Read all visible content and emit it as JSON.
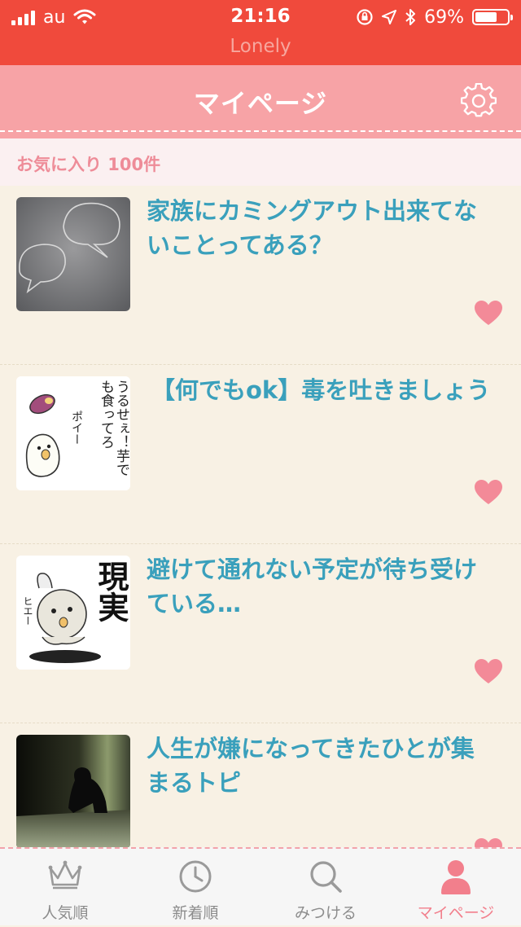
{
  "status_bar": {
    "carrier": "au",
    "time": "21:16",
    "battery": "69%",
    "battery_level": 0.69,
    "app_name": "Lonely"
  },
  "header": {
    "title": "マイページ",
    "settings_icon": "gear-icon"
  },
  "favorites": {
    "count_label": "お気に入り 100件"
  },
  "topics": [
    {
      "title": "家族にカミングアウト出来てないことってある？",
      "icon": "heart-icon"
    },
    {
      "title": "【何でもok】毒を吐きましょう",
      "icon": "heart-icon"
    },
    {
      "title": "避けて通れない予定が待ち受けている…",
      "icon": "heart-icon"
    },
    {
      "title": "人生が嫌になってきたひとが集まるトピ",
      "icon": "heart-icon"
    }
  ],
  "thumbnails": {
    "sticker_1_text": "うるせぇ！芋でも食ってろ",
    "sticker_1_sfx": "ポイー",
    "sticker_2_big": "現実",
    "sticker_2_sfx": "ヒエー"
  },
  "tabs": [
    {
      "label": "人気順",
      "icon": "crown-icon"
    },
    {
      "label": "新着順",
      "icon": "clock-icon"
    },
    {
      "label": "みつける",
      "icon": "search-icon"
    },
    {
      "label": "マイページ",
      "icon": "person-icon"
    }
  ],
  "colors": {
    "status_bar": "#f04a3c",
    "header": "#f7a3a6",
    "accent_pink": "#f27f8c",
    "topic_title": "#3aa0bc",
    "background": "#f8f1e4"
  }
}
